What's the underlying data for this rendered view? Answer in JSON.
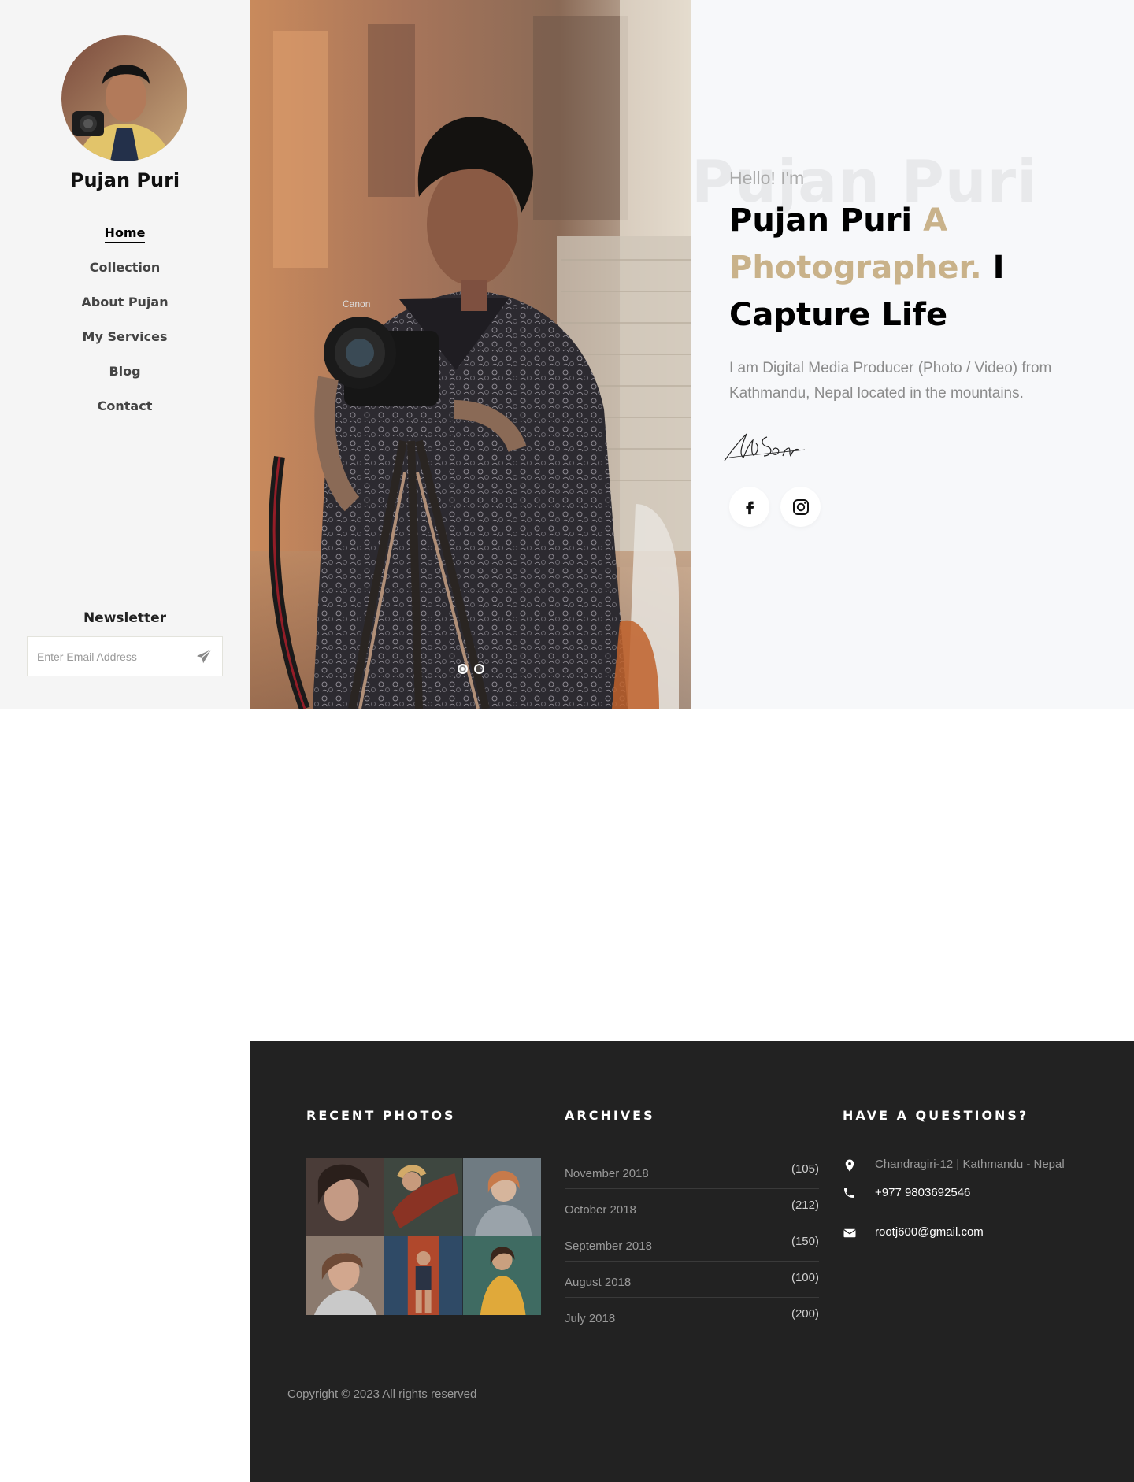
{
  "brand": {
    "name": "Pujan Puri"
  },
  "nav": {
    "items": [
      {
        "label": "Home",
        "active": true
      },
      {
        "label": "Collection"
      },
      {
        "label": "About Pujan"
      },
      {
        "label": "My Services"
      },
      {
        "label": "Blog"
      },
      {
        "label": "Contact"
      }
    ]
  },
  "newsletter": {
    "title": "Newsletter",
    "placeholder": "Enter Email Address",
    "send_icon": "paper-plane-icon"
  },
  "hero": {
    "ghost_text": "Pujan Puri",
    "greeting": "Hello! I'm",
    "name": "Pujan Puri",
    "accent": "A Photographer.",
    "tail": "I Capture Life",
    "description": "I am Digital Media Producer (Photo / Video) from Kathmandu, Nepal located in the mountains.",
    "signature": "handwritten-signature",
    "socials": [
      "facebook-icon",
      "instagram-icon"
    ],
    "slider": {
      "count": 2,
      "active": 1
    }
  },
  "footer": {
    "recent_photos_title": "RECENT PHOTOS",
    "archives_title": "ARCHIVES",
    "archives": [
      {
        "label": "November 2018",
        "count": "(105)"
      },
      {
        "label": "October 2018",
        "count": "(212)"
      },
      {
        "label": "September 2018",
        "count": "(150)"
      },
      {
        "label": "August 2018",
        "count": "(100)"
      },
      {
        "label": "July 2018",
        "count": "(200)"
      }
    ],
    "contact_title": "HAVE A QUESTIONS?",
    "contact": {
      "address": "Chandragiri-12 | Kathmandu - Nepal",
      "phone": "+977 9803692546",
      "email": "rootj600@gmail.com"
    },
    "copyright": "Copyright © 2023 All rights reserved"
  },
  "colors": {
    "accent": "#c9b28a",
    "sidebar_bg": "#f5f5f5",
    "hero_bg": "#f7f8fa",
    "footer_bg": "#222222"
  }
}
